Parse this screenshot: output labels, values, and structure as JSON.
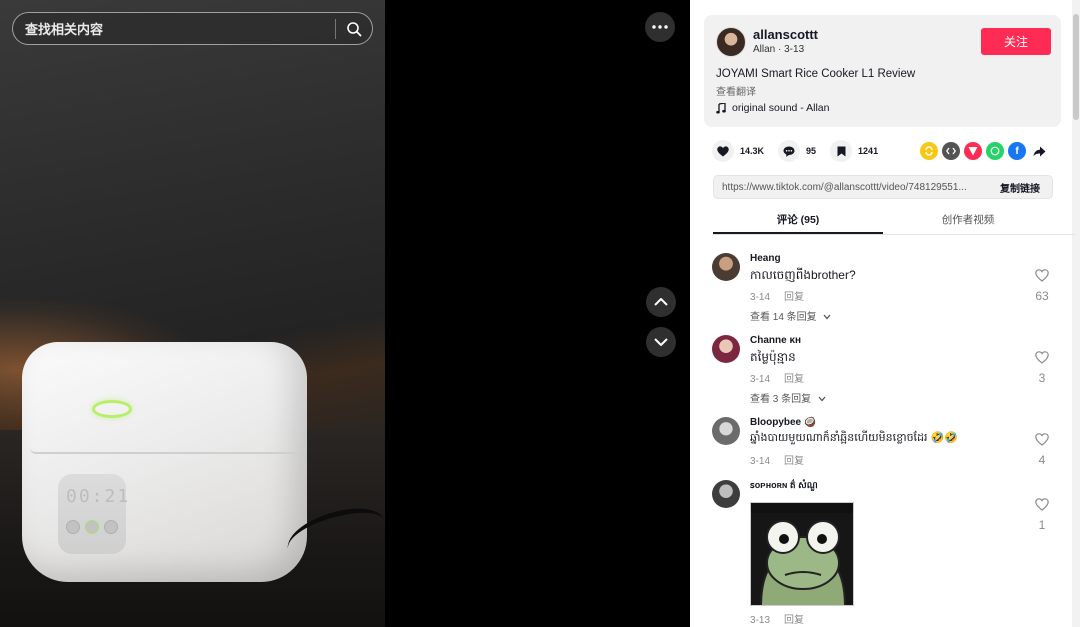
{
  "search": {
    "placeholder": "查找相关内容"
  },
  "video": {
    "screen_digits": "00:21"
  },
  "author": {
    "username": "allanscottt",
    "subtitle": "Allan · 3-13",
    "follow_label": "关注",
    "description": "JOYAMI Smart Rice Cooker L1 Review",
    "translate_label": "查看翻译",
    "music": "original sound - Allan"
  },
  "stats": {
    "likes": "14.3K",
    "comments": "95",
    "saves": "1241"
  },
  "share": {
    "icons": [
      "repost-icon",
      "embed-icon",
      "send-icon",
      "whatsapp-icon",
      "facebook-icon",
      "share-arrow-icon"
    ],
    "colors": {
      "repost": "#f8c816",
      "embed": "#545454",
      "send": "#fe2c55",
      "whatsapp": "#25d366",
      "facebook": "#1877f2"
    }
  },
  "link": {
    "url": "https://www.tiktok.com/@allanscottt/video/748129551...",
    "copy_label": "复制链接"
  },
  "tabs": {
    "comments": "评论 (95)",
    "creator_videos": "创作者视频"
  },
  "comments": [
    {
      "user": "Heang",
      "text": "កាលចេញពីងbrother?",
      "date": "3-14",
      "reply_label": "回复",
      "view_replies": "查看 14 条回复",
      "likes": "63"
    },
    {
      "user": "Channe ᴋʜ",
      "text": "តម្លៃប៉ុន្មាន",
      "date": "3-14",
      "reply_label": "回复",
      "view_replies": "查看 3 条回复",
      "likes": "3"
    },
    {
      "user": "Bloopybee 🥥",
      "text": "ឆ្នាំងបាយមួយណាក៏នាំឆ្អិនហើយមិនខ្លោចដែរ 🤣🤣",
      "date": "3-14",
      "reply_label": "回复",
      "likes": "4"
    },
    {
      "user": "ꜱᴏᴘʜᴏʀɴ ត៌ សំណួ",
      "text": "",
      "date": "3-13",
      "reply_label": "回复",
      "likes": "1"
    }
  ],
  "theme": {
    "accent": "#fe2c55"
  }
}
